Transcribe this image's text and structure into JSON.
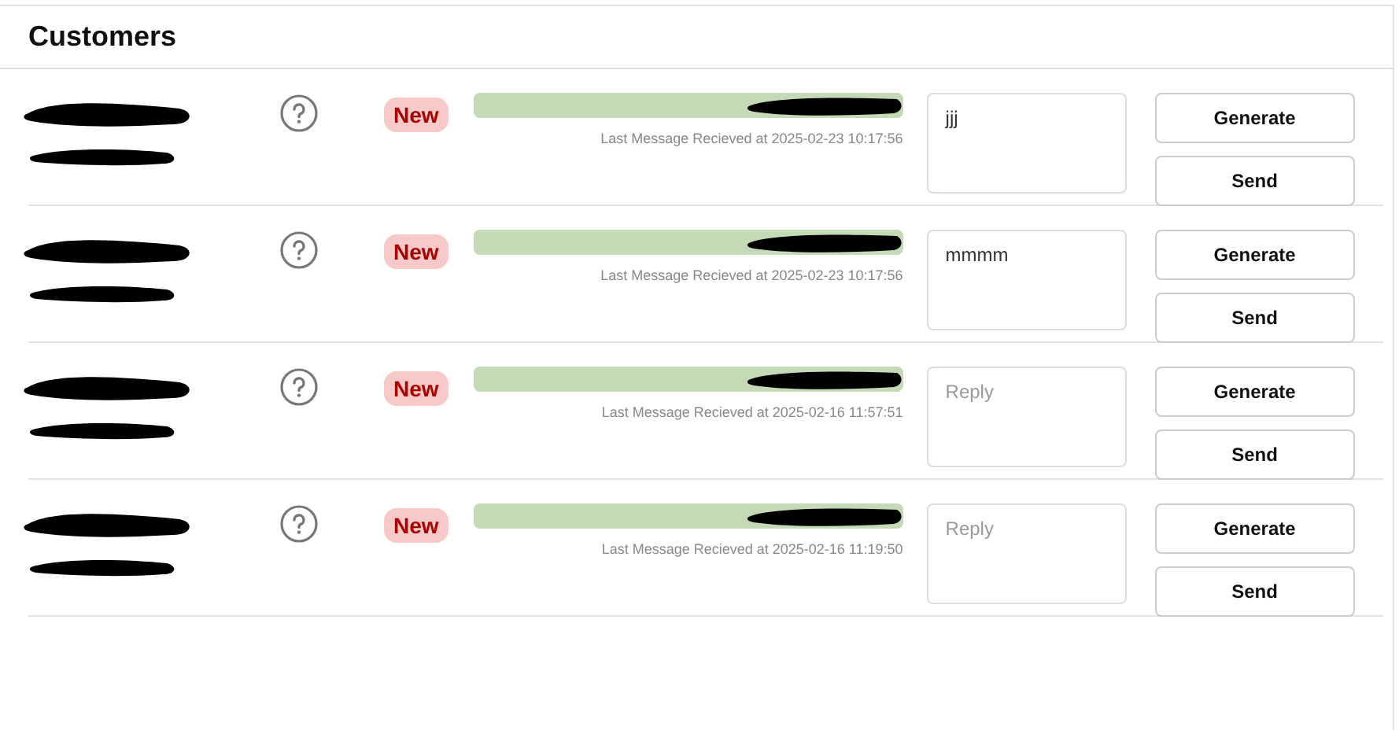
{
  "title": "Customers",
  "rows": [
    {
      "badge": "New",
      "timestamp": "Last Message Recieved at 2025-02-23 10:17:56",
      "reply": {
        "value": "jjj"
      },
      "buttons": [
        "Generate",
        "Send"
      ]
    },
    {
      "badge": "New",
      "timestamp": "Last Message Recieved at 2025-02-23 10:17:56",
      "reply": {
        "value": "mmmm"
      },
      "buttons": [
        "Generate",
        "Send"
      ]
    },
    {
      "badge": "New",
      "timestamp": "Last Message Recieved at 2025-02-16 11:57:51",
      "reply": {
        "placeholder": "Reply"
      },
      "buttons": [
        "Generate",
        "Send"
      ]
    },
    {
      "badge": "New",
      "timestamp": "Last Message Recieved at 2025-02-16 11:19:50",
      "reply": {
        "placeholder": "Reply"
      },
      "buttons": [
        "Generate",
        "Send"
      ]
    }
  ]
}
